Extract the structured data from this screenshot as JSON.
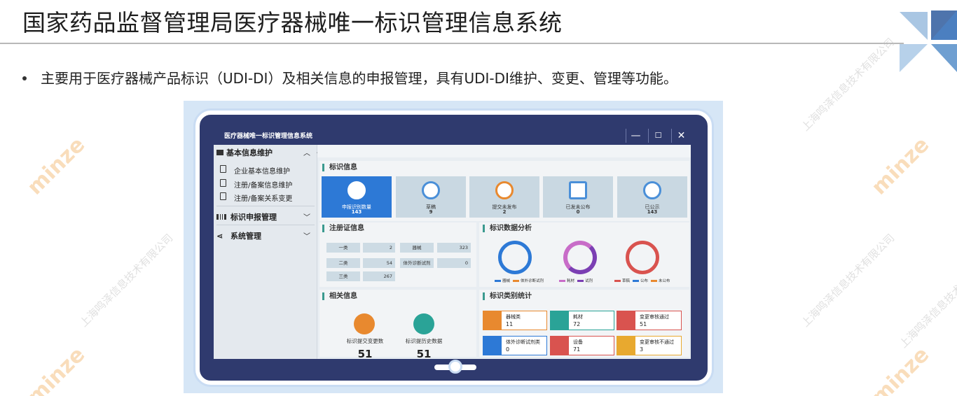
{
  "slide": {
    "title": "国家药品监督管理局医疗器械唯一标识管理信息系统",
    "bullet": "主要用于医疗器械产品标识（UDI-DI）及相关信息的申报管理，具有UDI-DI维护、变更、管理等功能。"
  },
  "watermark": {
    "text": "上海鸣泽信息技术有限公司",
    "logo_text": "minze"
  },
  "app": {
    "window_title": "医疗器械唯一标识管理信息系统",
    "controls": {
      "minimize": "—",
      "maximize": "☐",
      "close": "✕"
    },
    "sidebar": {
      "group1": "基本信息维护",
      "items": [
        "企业基本信息维护",
        "注册/备案信息维护",
        "注册/备案关系变更"
      ],
      "group2": "标识申报管理",
      "group3": "系统管理"
    },
    "sections": {
      "identity": "标识信息",
      "registration": "注册证信息",
      "analysis": "标识数据分析",
      "related": "相关信息",
      "category": "标识类别统计"
    },
    "tiles": [
      {
        "label": "申报识别数量",
        "value": "143"
      },
      {
        "label": "草稿",
        "value": "9"
      },
      {
        "label": "提交未发布",
        "value": "2"
      },
      {
        "label": "已发未公布",
        "value": "0"
      },
      {
        "label": "已公示",
        "value": "143"
      }
    ],
    "registration": {
      "class1_label": "一类",
      "class1_value": "2",
      "device_label": "器械",
      "device_value": "323",
      "class2_label": "二类",
      "class2_value": "54",
      "ivd_label": "体外诊断试剂",
      "ivd_value": "0",
      "class3_label": "三类",
      "class3_value": "267"
    },
    "analysis_legends": [
      [
        "器械",
        "体外诊断试剂"
      ],
      [
        "耗材",
        "试剂"
      ],
      [
        "草稿",
        "公布",
        "未公布"
      ]
    ],
    "related": [
      {
        "label": "标识提交变更数",
        "value": "51"
      },
      {
        "label": "标识提历史数据",
        "value": "51"
      }
    ],
    "category": [
      {
        "label": "器械类",
        "value": "11"
      },
      {
        "label": "耗材",
        "value": "72"
      },
      {
        "label": "变更审核通过",
        "value": "51"
      },
      {
        "label": "体外诊断试剂类",
        "value": "0"
      },
      {
        "label": "设备",
        "value": "71"
      },
      {
        "label": "变更审核不通过",
        "value": "3"
      }
    ],
    "colors": {
      "accent": "#2d79d6",
      "frame": "#2f3a6e",
      "orange": "#e8892f",
      "red": "#d9534f",
      "teal": "#2aa397",
      "purple": "#9b59b6"
    }
  }
}
